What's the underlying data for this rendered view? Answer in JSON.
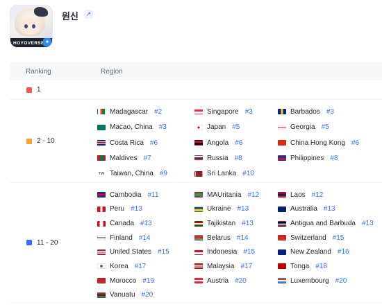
{
  "app": {
    "title": "원신",
    "icon_brand": "HOYOVERSE",
    "store_icon": "app-store-icon",
    "link_icon": "external-link-icon"
  },
  "table": {
    "col_ranking": "Ranking",
    "col_region": "Region"
  },
  "groups": [
    {
      "rank": "1",
      "color": "#f2575a",
      "regions": []
    },
    {
      "rank": "2 - 10",
      "color": "#f7a52f",
      "regions": [
        {
          "name": "Madagascar",
          "rank": "#2",
          "flag": "linear-gradient(to right,#ffffff 0 33%,#fc3d32 33% 66%,#007e3a 66%)"
        },
        {
          "name": "Singapore",
          "rank": "#3",
          "flag": "linear-gradient(#ef3340 0 50%,#ffffff 50%)"
        },
        {
          "name": "Barbados",
          "rank": "#3",
          "flag": "linear-gradient(to right,#00267f 0 33%,#ffc726 33% 66%,#00267f 66%)"
        },
        {
          "name": "Macao, China",
          "rank": "#3",
          "flag": "#00785e"
        },
        {
          "name": "Japan",
          "rank": "#5",
          "flag": "radial-gradient(circle,#bc002d 0 28%,#ffffff 30%)"
        },
        {
          "name": "Georgia",
          "rank": "#5",
          "flag": "linear-gradient(#ffffff 0 40%,#ff0000 40% 60%,#ffffff 60%)"
        },
        {
          "name": "Costa Rica",
          "rank": "#6",
          "flag": "linear-gradient(#002b7f 0 17%,#ffffff 17% 33%,#ce1126 33% 67%,#ffffff 67% 83%,#002b7f 83%)"
        },
        {
          "name": "Angola",
          "rank": "#6",
          "flag": "linear-gradient(#cc092f 0 50%,#000000 50%)"
        },
        {
          "name": "China Hong Kong",
          "rank": "#6",
          "flag": "#de2910"
        },
        {
          "name": "Maldives",
          "rank": "#7",
          "flag": "radial-gradient(circle,#007e3a 0 55%,#d21034 56%)"
        },
        {
          "name": "Russia",
          "rank": "#8",
          "flag": "linear-gradient(#ffffff 0 33%,#0039a6 33% 66%,#d52b1e 66%)"
        },
        {
          "name": "Philippines",
          "rank": "#8",
          "flag": "linear-gradient(#0038a8 0 50%,#ce1126 50%)"
        },
        {
          "name": "Taiwan, China",
          "rank": "#9",
          "flag": "TW"
        },
        {
          "name": "Sri Lanka",
          "rank": "#10",
          "flag": "linear-gradient(to right,#ffbe29 0 10%,#8d2029 10%)"
        }
      ]
    },
    {
      "rank": "11 - 20",
      "color": "#3370ff",
      "regions": [
        {
          "name": "Cambodia",
          "rank": "#11",
          "flag": "linear-gradient(#032ea1 0 25%,#e00025 25% 75%,#032ea1 75%)"
        },
        {
          "name": "MAUritania",
          "rank": "#12",
          "flag": "linear-gradient(#d01c1f 0 15%,#00a95c 15% 85%,#d01c1f 85%)"
        },
        {
          "name": "Laos",
          "rank": "#12",
          "flag": "linear-gradient(#ce1126 0 25%,#002868 25% 75%,#ce1126 75%)"
        },
        {
          "name": "Peru",
          "rank": "#13",
          "flag": "linear-gradient(to right,#d91023 0 33%,#ffffff 33% 66%,#d91023 66%)"
        },
        {
          "name": "Ukraine",
          "rank": "#13",
          "flag": "linear-gradient(#0057b7 0 50%,#ffd700 50%)"
        },
        {
          "name": "Australia",
          "rank": "#13",
          "flag": "#012169"
        },
        {
          "name": "Canada",
          "rank": "#13",
          "flag": "linear-gradient(to right,#d80621 0 25%,#ffffff 25% 75%,#d80621 75%)"
        },
        {
          "name": "Tajikistan",
          "rank": "#13",
          "flag": "linear-gradient(#cc0000 0 30%,#ffffff 30% 70%,#006600 70%)"
        },
        {
          "name": "Antigua and Barbuda",
          "rank": "#13",
          "flag": "linear-gradient(#000000 0 35%,#0072c6 35% 60%,#ffffff 60% 75%,#ce1126 75%)"
        },
        {
          "name": "Finland",
          "rank": "#14",
          "flag": "linear-gradient(#ffffff 0 38%,#002f6c 38% 62%,#ffffff 62%)"
        },
        {
          "name": "Belarus",
          "rank": "#14",
          "flag": "linear-gradient(#c8313e 0 66%,#4aa657 66%)"
        },
        {
          "name": "Switzerland",
          "rank": "#15",
          "flag": "#d52b1e"
        },
        {
          "name": "United States",
          "rank": "#15",
          "flag": "repeating-linear-gradient(#b22234 0 1.2px,#ffffff 1.2px 2.4px)"
        },
        {
          "name": "Indonesia",
          "rank": "#15",
          "flag": "linear-gradient(#ce1126 0 50%,#ffffff 50%)"
        },
        {
          "name": "New Zealand",
          "rank": "#16",
          "flag": "#00247d"
        },
        {
          "name": "Korea",
          "rank": "#17",
          "flag": "radial-gradient(circle,#cd2e3a 0 20%,#0047a0 20% 30%,#ffffff 32%)"
        },
        {
          "name": "Malaysia",
          "rank": "#17",
          "flag": "repeating-linear-gradient(#cc0001 0 1.2px,#ffffff 1.2px 2.4px)"
        },
        {
          "name": "Tonga",
          "rank": "#18",
          "flag": "#c10000"
        },
        {
          "name": "Morocco",
          "rank": "#19",
          "flag": "#c1272d"
        },
        {
          "name": "Austria",
          "rank": "#20",
          "flag": "linear-gradient(#ed2939 0 33%,#ffffff 33% 66%,#ed2939 66%)"
        },
        {
          "name": "Luxembourg",
          "rank": "#20",
          "flag": "linear-gradient(#ed2939 0 33%,#ffffff 33% 66%,#00a1de 66%)"
        },
        {
          "name": "Vanuatu",
          "rank": "#20",
          "flag": "linear-gradient(#d21034 0 45%,#000000 45% 55%,#009543 55%)"
        }
      ]
    }
  ]
}
